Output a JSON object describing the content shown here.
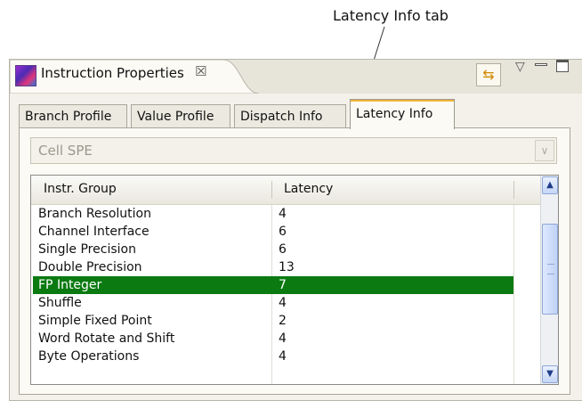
{
  "callout": {
    "text": "Latency Info tab"
  },
  "view": {
    "title": "Instruction Properties",
    "close_glyph": "☒",
    "app_icon": "instruction-properties-icon",
    "tools": {
      "sync_glyph": "⇆",
      "menu_glyph": "▽"
    }
  },
  "tabs": [
    {
      "label": "Branch Profile",
      "active": false
    },
    {
      "label": "Value Profile",
      "active": false
    },
    {
      "label": "Dispatch Info",
      "active": false
    },
    {
      "label": "Latency Info",
      "active": true
    }
  ],
  "combo": {
    "value": "Cell SPE",
    "arrow": "∨"
  },
  "table": {
    "columns": [
      "Instr. Group",
      "Latency"
    ],
    "rows": [
      {
        "group": "Branch Resolution",
        "latency": "4",
        "selected": false
      },
      {
        "group": "Channel Interface",
        "latency": "6",
        "selected": false
      },
      {
        "group": "Single Precision",
        "latency": "6",
        "selected": false
      },
      {
        "group": "Double Precision",
        "latency": "13",
        "selected": false
      },
      {
        "group": "FP Integer",
        "latency": "7",
        "selected": true
      },
      {
        "group": "Shuffle",
        "latency": "4",
        "selected": false
      },
      {
        "group": "Simple Fixed Point",
        "latency": "2",
        "selected": false
      },
      {
        "group": "Word Rotate and Shift",
        "latency": "4",
        "selected": false
      },
      {
        "group": "Byte Operations",
        "latency": "4",
        "selected": false
      }
    ],
    "scroll": {
      "up": "▲",
      "down": "▼"
    }
  },
  "colors": {
    "selection": "#0a7a11",
    "active_tab_accent": "#f3b43a"
  }
}
